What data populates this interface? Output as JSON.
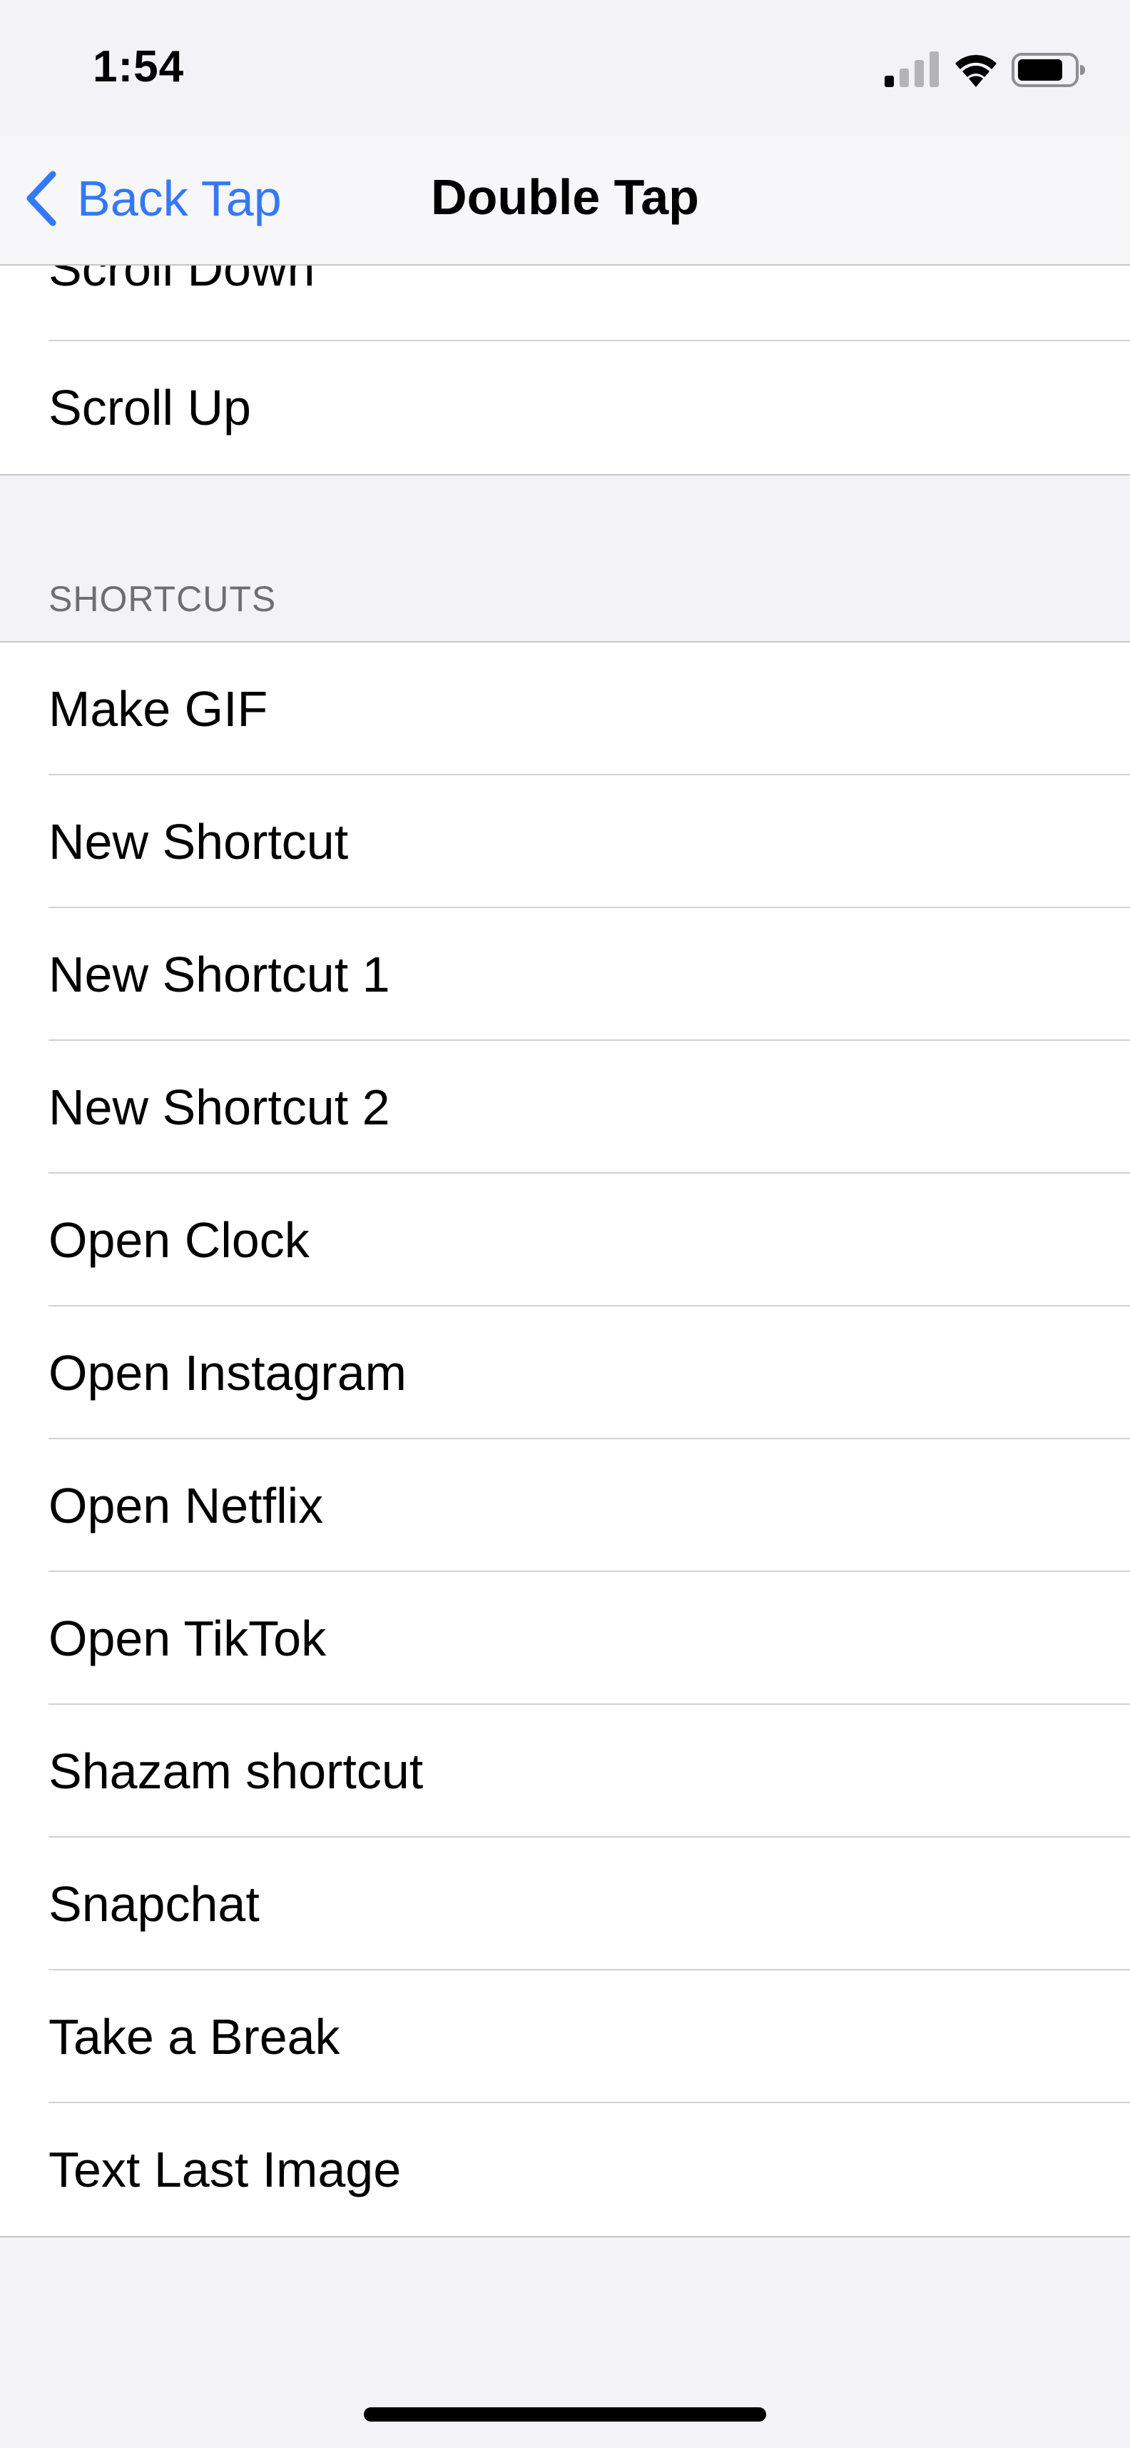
{
  "status_bar": {
    "time": "1:54",
    "icons": [
      "cellular-signal-icon",
      "wifi-icon",
      "battery-icon"
    ]
  },
  "nav": {
    "back_label": "Back Tap",
    "title": "Double Tap",
    "accent_color": "#3478f6"
  },
  "top_group": {
    "items": [
      {
        "label": "Scroll Down"
      },
      {
        "label": "Scroll Up"
      }
    ]
  },
  "shortcuts": {
    "header": "SHORTCUTS",
    "items": [
      {
        "label": "Make GIF"
      },
      {
        "label": "New Shortcut"
      },
      {
        "label": "New Shortcut 1"
      },
      {
        "label": "New Shortcut 2"
      },
      {
        "label": "Open Clock"
      },
      {
        "label": "Open Instagram"
      },
      {
        "label": "Open Netflix"
      },
      {
        "label": "Open TikTok"
      },
      {
        "label": "Shazam shortcut"
      },
      {
        "label": "Snapchat"
      },
      {
        "label": "Take a Break"
      },
      {
        "label": "Text Last Image"
      }
    ]
  }
}
